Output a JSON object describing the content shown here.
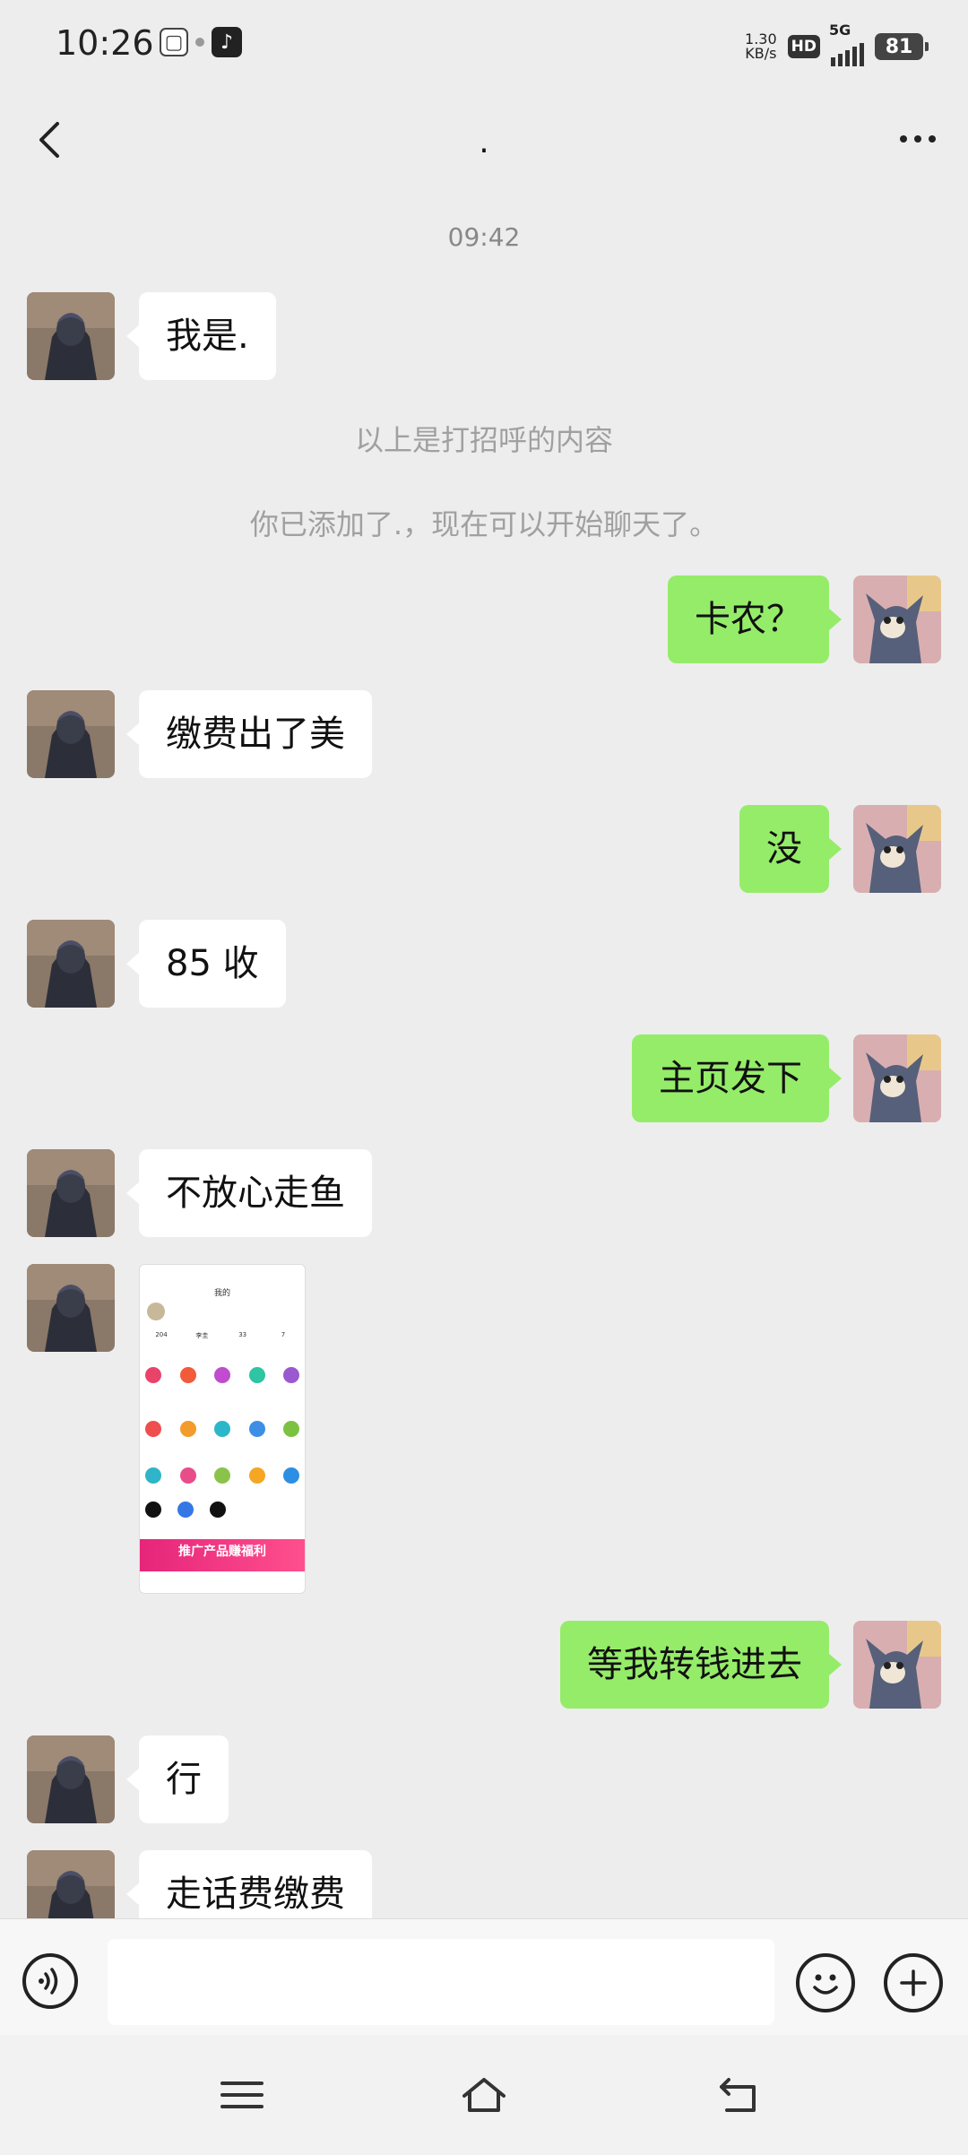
{
  "status_bar": {
    "time": "10:26",
    "net_speed_value": "1.30",
    "net_speed_unit": "KB/s",
    "hd": "HD",
    "network": "5G",
    "battery": "81"
  },
  "header": {
    "title": "."
  },
  "chat": {
    "timestamp": "09:42",
    "system_messages": [
      "以上是打招呼的内容",
      "你已添加了.，现在可以开始聊天了。"
    ],
    "messages": [
      {
        "side": "in",
        "text": "我是."
      },
      {
        "side": "out",
        "text": "卡农？"
      },
      {
        "side": "in",
        "text": "缴费出了美"
      },
      {
        "side": "out",
        "text": "没"
      },
      {
        "side": "in",
        "text": "85 收"
      },
      {
        "side": "out",
        "text": "主页发下"
      },
      {
        "side": "in",
        "text": "不放心走鱼"
      },
      {
        "side": "in",
        "type": "image"
      },
      {
        "side": "out",
        "text": "等我转钱进去"
      },
      {
        "side": "in",
        "text": "行"
      },
      {
        "side": "in",
        "text": "走话费缴费"
      }
    ],
    "image_message": {
      "title": "我的",
      "stats": [
        "204",
        "李圭",
        "33",
        "7"
      ],
      "banner": "推广产品赚福利"
    }
  },
  "input_bar": {
    "placeholder": ""
  },
  "colors": {
    "background": "#ededed",
    "outgoing_bubble": "#95ec69",
    "incoming_bubble": "#ffffff"
  },
  "icons": [
    "back-arrow",
    "more-dots",
    "voice",
    "emoji",
    "plus",
    "menu",
    "home",
    "back"
  ]
}
